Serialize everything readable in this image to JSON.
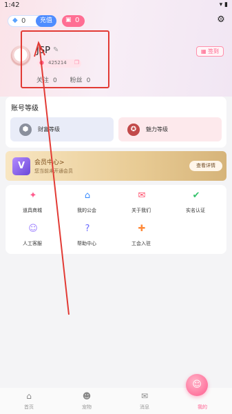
{
  "status_bar": {
    "time": "1:42",
    "system_icons": "▾ ▮"
  },
  "wallet": {
    "diamond_icon": "diamond-icon",
    "diamond_count": "0",
    "recharge_label": "充值",
    "card_icon": "ticket-icon",
    "card_count": "0"
  },
  "profile": {
    "username": "JSP",
    "user_id": "425214",
    "follow_label": "关注",
    "follow_count": "0",
    "fans_label": "粉丝",
    "fans_count": "0",
    "signin_label": "签到"
  },
  "account_level": {
    "title": "账号等级",
    "wealth_label": "财富等级",
    "charm_label": "魅力等级"
  },
  "vip": {
    "title": "会员中心",
    "arrow": ">",
    "subtitle": "您当前未开通会员",
    "detail_label": "查看详情",
    "badge": "V"
  },
  "menu": {
    "items": [
      {
        "label": "道具商城",
        "icon": "wand-icon",
        "glyph": "✦",
        "color": "#ff5c8e"
      },
      {
        "label": "我的公会",
        "icon": "home-icon",
        "glyph": "⌂",
        "color": "#3a8cff"
      },
      {
        "label": "关于我们",
        "icon": "mail-icon",
        "glyph": "✉",
        "color": "#ff4e6b"
      },
      {
        "label": "实名认证",
        "icon": "verified-icon",
        "glyph": "✔",
        "color": "#33c26a"
      },
      {
        "label": "人工客服",
        "icon": "headset-icon",
        "glyph": "☺",
        "color": "#9a7cff"
      },
      {
        "label": "帮助中心",
        "icon": "help-icon",
        "glyph": "?",
        "color": "#6b6bff"
      },
      {
        "label": "工会入驻",
        "icon": "user-plus-icon",
        "glyph": "✚",
        "color": "#ff8a3a"
      }
    ]
  },
  "tabbar": {
    "items": [
      {
        "label": "首页",
        "icon": "home-tab-icon",
        "glyph": "⌂"
      },
      {
        "label": "宠物",
        "icon": "pet-tab-icon",
        "glyph": "☻"
      },
      {
        "label": "消息",
        "icon": "message-tab-icon",
        "glyph": "✉"
      },
      {
        "label": "我的",
        "icon": "profile-tab-icon",
        "glyph": "☺"
      }
    ]
  }
}
